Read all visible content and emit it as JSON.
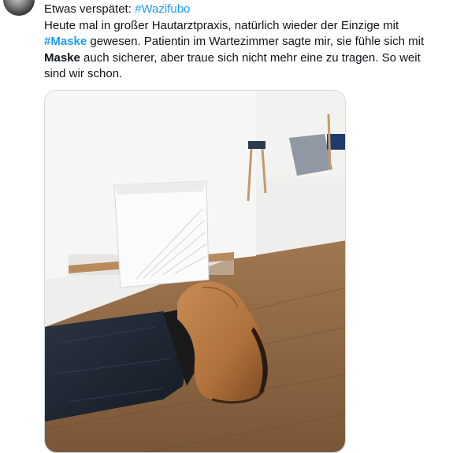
{
  "tweet": {
    "line1": {
      "prefix": "Etwas verspätet: ",
      "hashtag": "#Wazifubo"
    },
    "line2": "Heute mal in großer Hautarztpraxis, natürlich wieder der Einzige mit",
    "line3": {
      "hashtag": "#Maske",
      "rest": " gewesen. Patientin im Wartezimmer sagte mir, sie fühle sich mit"
    },
    "line4": {
      "bold": "Maske",
      "rest": " auch sicherer, aber traue sich nicht mehr eine zu tragen. So weit"
    },
    "line5": "sind wir schon."
  },
  "colors": {
    "hashtag": "#1d9bf0",
    "text": "#0f1419",
    "border": "#cfd9de"
  }
}
